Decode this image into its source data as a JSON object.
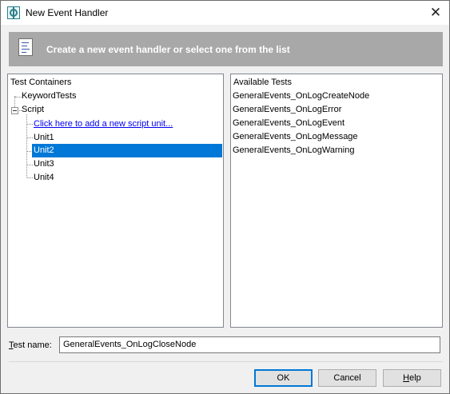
{
  "window": {
    "title": "New Event Handler",
    "close_glyph": "✕",
    "icon": "testcomplete-app-icon"
  },
  "banner": {
    "text": "Create a new event handler or select one from the list",
    "icon": "script-document-icon"
  },
  "test_containers": {
    "header": "Test Containers",
    "items": [
      {
        "label": "KeywordTests"
      },
      {
        "label": "Script",
        "expanded": true
      },
      {
        "label": "Click here to add a new script unit..."
      },
      {
        "label": "Unit1"
      },
      {
        "label": "Unit2",
        "selected": true
      },
      {
        "label": "Unit3"
      },
      {
        "label": "Unit4"
      }
    ]
  },
  "available_tests": {
    "header": "Available Tests",
    "items": [
      "GeneralEvents_OnLogCreateNode",
      "GeneralEvents_OnLogError",
      "GeneralEvents_OnLogEvent",
      "GeneralEvents_OnLogMessage",
      "GeneralEvents_OnLogWarning"
    ]
  },
  "test_name": {
    "label_mnemonic": "T",
    "label_rest": "est name:",
    "value": "GeneralEvents_OnLogCloseNode"
  },
  "buttons": {
    "ok": "OK",
    "cancel": "Cancel",
    "help_mnemonic": "H",
    "help_rest": "elp"
  },
  "colors": {
    "selection": "#0078d7",
    "banner_bg": "#a8a8a8",
    "link": "#0000ee"
  }
}
